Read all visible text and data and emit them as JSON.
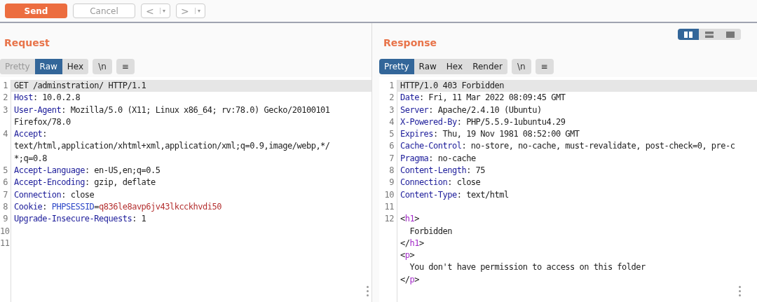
{
  "toolbar": {
    "send": "Send",
    "cancel": "Cancel",
    "back": "<",
    "forward": ">",
    "dropdown": "▾"
  },
  "layout_toggle": [
    {
      "kind": "columns",
      "selected": true
    },
    {
      "kind": "rows",
      "selected": false
    },
    {
      "kind": "single",
      "selected": false
    }
  ],
  "request": {
    "title": "Request",
    "tabs": [
      {
        "label": "Pretty",
        "selected": false
      },
      {
        "label": "Raw",
        "selected": true
      },
      {
        "label": "Hex",
        "selected": false
      }
    ],
    "newline": "\\n",
    "menu": "≡",
    "lines": [
      {
        "number": "1",
        "highlighted": true,
        "segments": [
          {
            "kind": "plain",
            "text": "GET /adminstration/ HTTP/1.1"
          }
        ]
      },
      {
        "number": "2",
        "highlighted": false,
        "segments": [
          {
            "kind": "key",
            "text": "Host"
          },
          {
            "kind": "plain",
            "text": ": 10.0.2.8"
          }
        ]
      },
      {
        "number": "3",
        "highlighted": false,
        "segments": [
          {
            "kind": "key",
            "text": "User-Agent"
          },
          {
            "kind": "plain",
            "text": ": Mozilla/5.0 (X11; Linux x86_64; rv:78.0) Gecko/20100101"
          }
        ]
      },
      {
        "highlighted": false,
        "segments": [
          {
            "kind": "plain",
            "text": "Firefox/78.0"
          }
        ]
      },
      {
        "number": "4",
        "highlighted": false,
        "segments": [
          {
            "kind": "key",
            "text": "Accept"
          },
          {
            "kind": "plain",
            "text": ":"
          }
        ]
      },
      {
        "highlighted": false,
        "segments": [
          {
            "kind": "plain",
            "text": "text/html,application/xhtml+xml,application/xml;q=0.9,image/webp,*/"
          }
        ]
      },
      {
        "highlighted": false,
        "segments": [
          {
            "kind": "plain",
            "text": "*;q=0.8"
          }
        ]
      },
      {
        "number": "5",
        "highlighted": false,
        "segments": [
          {
            "kind": "key",
            "text": "Accept-Language"
          },
          {
            "kind": "plain",
            "text": ": en-US,en;q=0.5"
          }
        ]
      },
      {
        "number": "6",
        "highlighted": false,
        "segments": [
          {
            "kind": "key",
            "text": "Accept-Encoding"
          },
          {
            "kind": "plain",
            "text": ": gzip, deflate"
          }
        ]
      },
      {
        "number": "7",
        "highlighted": false,
        "segments": [
          {
            "kind": "key",
            "text": "Connection"
          },
          {
            "kind": "plain",
            "text": ": close"
          }
        ]
      },
      {
        "number": "8",
        "highlighted": false,
        "segments": [
          {
            "kind": "key",
            "text": "Cookie"
          },
          {
            "kind": "plain",
            "text": ": "
          },
          {
            "kind": "param",
            "text": "PHPSESSID"
          },
          {
            "kind": "plain",
            "text": "="
          },
          {
            "kind": "value",
            "text": "q836le8avp6jv43lkcckhvdi50"
          }
        ]
      },
      {
        "number": "9",
        "highlighted": false,
        "segments": [
          {
            "kind": "key",
            "text": "Upgrade-Insecure-Requests"
          },
          {
            "kind": "plain",
            "text": ": 1"
          }
        ]
      },
      {
        "number": "10",
        "highlighted": false
      },
      {
        "number": "11",
        "highlighted": false
      }
    ]
  },
  "response": {
    "title": "Response",
    "tabs": [
      {
        "label": "Pretty",
        "selected": true
      },
      {
        "label": "Raw",
        "selected": false
      },
      {
        "label": "Hex",
        "selected": false
      },
      {
        "label": "Render",
        "selected": false
      }
    ],
    "newline": "\\n",
    "menu": "≡",
    "lines": [
      {
        "number": "1",
        "highlighted": true,
        "segments": [
          {
            "kind": "plain",
            "text": "HTTP/1.0 403 Forbidden"
          }
        ]
      },
      {
        "number": "2",
        "highlighted": false,
        "segments": [
          {
            "kind": "key",
            "text": "Date"
          },
          {
            "kind": "plain",
            "text": ": Fri, 11 Mar 2022 08:09:45 GMT"
          }
        ]
      },
      {
        "number": "3",
        "highlighted": false,
        "segments": [
          {
            "kind": "key",
            "text": "Server"
          },
          {
            "kind": "plain",
            "text": ": Apache/2.4.10 (Ubuntu)"
          }
        ]
      },
      {
        "number": "4",
        "highlighted": false,
        "segments": [
          {
            "kind": "key",
            "text": "X-Powered-By"
          },
          {
            "kind": "plain",
            "text": ": PHP/5.5.9-1ubuntu4.29"
          }
        ]
      },
      {
        "number": "5",
        "highlighted": false,
        "segments": [
          {
            "kind": "key",
            "text": "Expires"
          },
          {
            "kind": "plain",
            "text": ": Thu, 19 Nov 1981 08:52:00 GMT"
          }
        ]
      },
      {
        "number": "6",
        "highlighted": false,
        "segments": [
          {
            "kind": "key",
            "text": "Cache-Control"
          },
          {
            "kind": "plain",
            "text": ": no-store, no-cache, must-revalidate, post-check=0, pre-c"
          }
        ]
      },
      {
        "number": "7",
        "highlighted": false,
        "segments": [
          {
            "kind": "key",
            "text": "Pragma"
          },
          {
            "kind": "plain",
            "text": ": no-cache"
          }
        ]
      },
      {
        "number": "8",
        "highlighted": false,
        "segments": [
          {
            "kind": "key",
            "text": "Content-Length"
          },
          {
            "kind": "plain",
            "text": ": 75"
          }
        ]
      },
      {
        "number": "9",
        "highlighted": false,
        "segments": [
          {
            "kind": "key",
            "text": "Connection"
          },
          {
            "kind": "plain",
            "text": ": close"
          }
        ]
      },
      {
        "number": "10",
        "highlighted": false,
        "segments": [
          {
            "kind": "key",
            "text": "Content-Type"
          },
          {
            "kind": "plain",
            "text": ": text/html"
          }
        ]
      },
      {
        "number": "11",
        "highlighted": false
      },
      {
        "number": "12",
        "highlighted": false,
        "segments": [
          {
            "kind": "plain",
            "text": "<"
          },
          {
            "kind": "tag",
            "text": "h1"
          },
          {
            "kind": "plain",
            "text": ">"
          }
        ]
      },
      {
        "highlighted": false,
        "segments": [
          {
            "kind": "plain",
            "text": "  Forbidden"
          }
        ]
      },
      {
        "highlighted": false,
        "segments": [
          {
            "kind": "plain",
            "text": "</"
          },
          {
            "kind": "tag",
            "text": "h1"
          },
          {
            "kind": "plain",
            "text": ">"
          }
        ]
      },
      {
        "highlighted": false,
        "segments": [
          {
            "kind": "plain",
            "text": "<"
          },
          {
            "kind": "tag",
            "text": "p"
          },
          {
            "kind": "plain",
            "text": ">"
          }
        ]
      },
      {
        "highlighted": false,
        "segments": [
          {
            "kind": "plain",
            "text": "  You don't have permission to access on this folder"
          }
        ]
      },
      {
        "highlighted": false,
        "segments": [
          {
            "kind": "plain",
            "text": "</"
          },
          {
            "kind": "tag",
            "text": "p"
          },
          {
            "kind": "plain",
            "text": ">"
          }
        ]
      }
    ]
  }
}
